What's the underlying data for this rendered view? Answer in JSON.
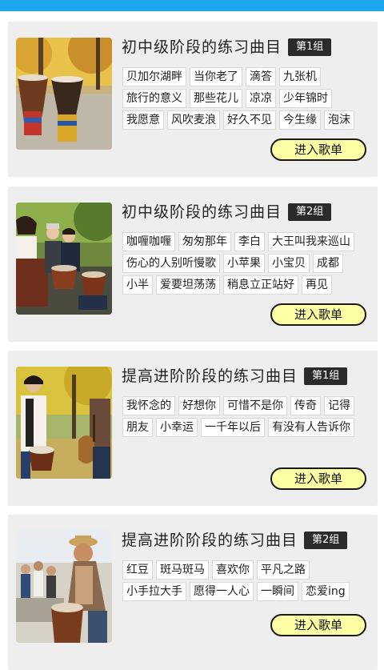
{
  "cards": [
    {
      "title": "初中级阶段的练习曲目",
      "group": "第1组",
      "songs": [
        "贝加尔湖畔",
        "当你老了",
        "滴答",
        "九张机",
        "旅行的意义",
        "那些花儿",
        "凉凉",
        "少年锦时",
        "我愿意",
        "风吹麦浪",
        "好久不见",
        "今生缘",
        "泡沫"
      ],
      "button": "进入歌单",
      "image": "djembe-drums-autumn-photo"
    },
    {
      "title": "初中级阶段的练习曲目",
      "group": "第2组",
      "songs": [
        "咖喱咖喱",
        "匆匆那年",
        "李白",
        "大王叫我来巡山",
        "伤心的人别听慢歌",
        "小苹果",
        "小宝贝",
        "成都",
        "小半",
        "爱要坦荡荡",
        "稍息立正站好",
        "再见"
      ],
      "button": "进入歌单",
      "image": "group-drumming-photo"
    },
    {
      "title": "提高进阶阶段的练习曲目",
      "group": "第1组",
      "songs": [
        "我怀念的",
        "好想你",
        "可惜不是你",
        "传奇",
        "记得",
        "朋友",
        "小幸运",
        "一千年以后",
        "有没有人告诉你"
      ],
      "button": "进入歌单",
      "image": "drum-and-guitar-park-photo"
    },
    {
      "title": "提高进阶阶段的练习曲目",
      "group": "第2组",
      "songs": [
        "红豆",
        "斑马斑马",
        "喜欢你",
        "平凡之路",
        "小手拉大手",
        "愿得一人心",
        "一瞬间",
        "恋爱ing"
      ],
      "button": "进入歌单",
      "image": "drum-circle-performer-photo"
    }
  ]
}
